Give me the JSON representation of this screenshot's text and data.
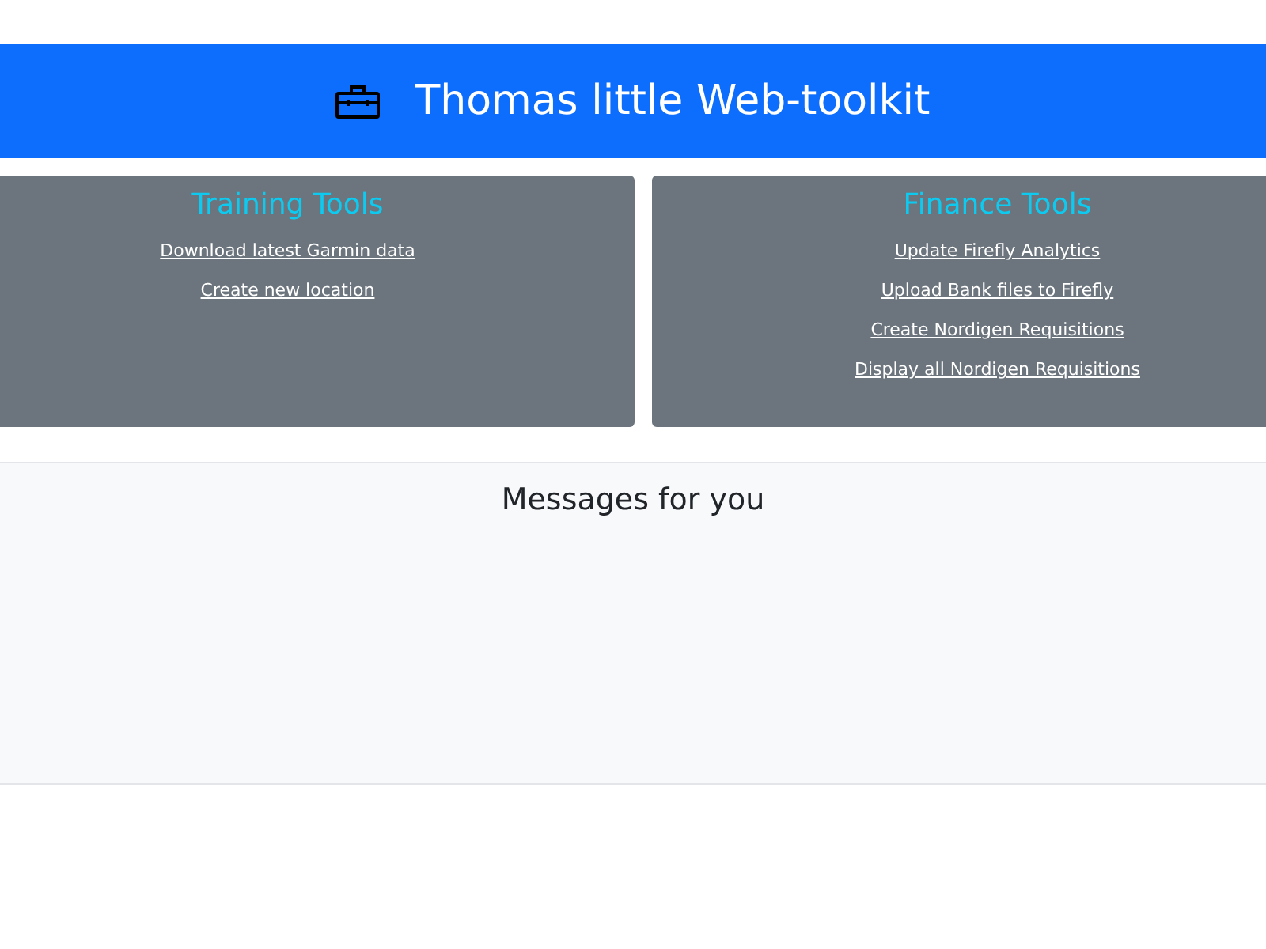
{
  "header": {
    "title": "Thomas little Web-toolkit"
  },
  "tool_groups": [
    {
      "title": "Training Tools",
      "links": [
        "Download latest Garmin data",
        "Create new location"
      ]
    },
    {
      "title": "Finance Tools",
      "links": [
        "Update Firefly Analytics",
        "Upload Bank files to Firefly",
        "Create Nordigen Requisitions",
        "Display all Nordigen Requisitions"
      ]
    }
  ],
  "messages": {
    "title": "Messages for you"
  }
}
